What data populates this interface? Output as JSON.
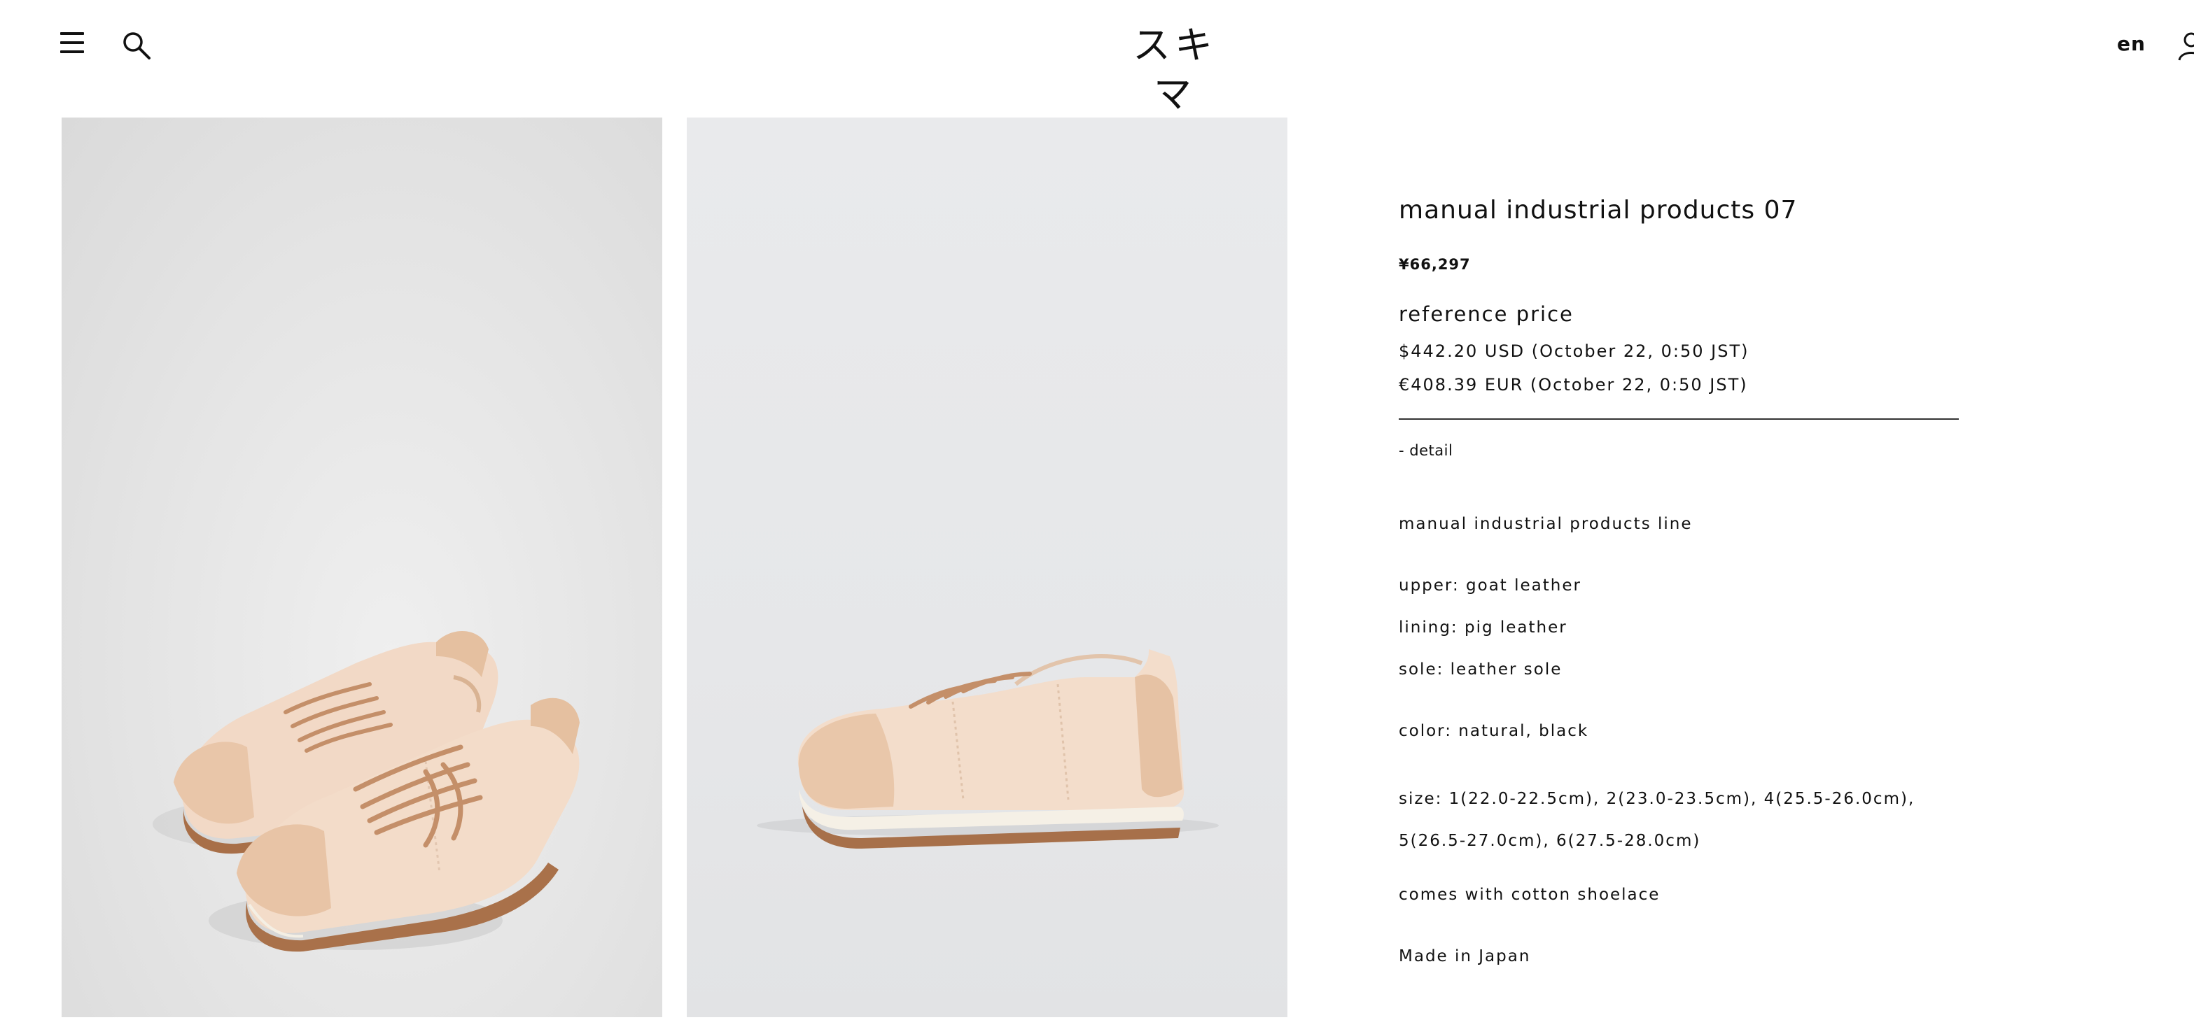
{
  "header": {
    "logo_text": "スキマ",
    "language": "en",
    "icons": {
      "menu": "hamburger-menu-icon",
      "search": "search-icon",
      "account": "user-account-icon"
    }
  },
  "product": {
    "title": "manual industrial products 07",
    "price": "¥66,297",
    "reference_heading": "reference price",
    "reference_usd": "$442.20 USD (October 22, 0:50 JST)",
    "reference_eur": "€408.39 EUR (October 22, 0:50 JST)",
    "detail_label": "- detail",
    "specs": {
      "line": "manual industrial products line",
      "upper": "upper: goat leather",
      "lining": "lining: pig leather",
      "sole": "sole: leather sole",
      "color": "color: natural, black",
      "size": "size: 1(22.0-22.5cm), 2(23.0-23.5cm), 4(25.5-26.0cm), 5(26.5-27.0cm), 6(27.5-28.0cm)",
      "shoelace": "comes with cotton shoelace",
      "origin": "Made in Japan"
    }
  },
  "images": [
    {
      "subject": "pair of natural leather sneakers, top angle view"
    },
    {
      "subject": "single natural leather sneaker, side view"
    }
  ],
  "colors": {
    "background": "#ffffff",
    "text": "#111111",
    "photo_background": "#e6e6e6",
    "leather": "#f1d7c4",
    "suede": "#e8c4a6",
    "sole": "#a9714a",
    "midsole": "#f4efe4"
  }
}
